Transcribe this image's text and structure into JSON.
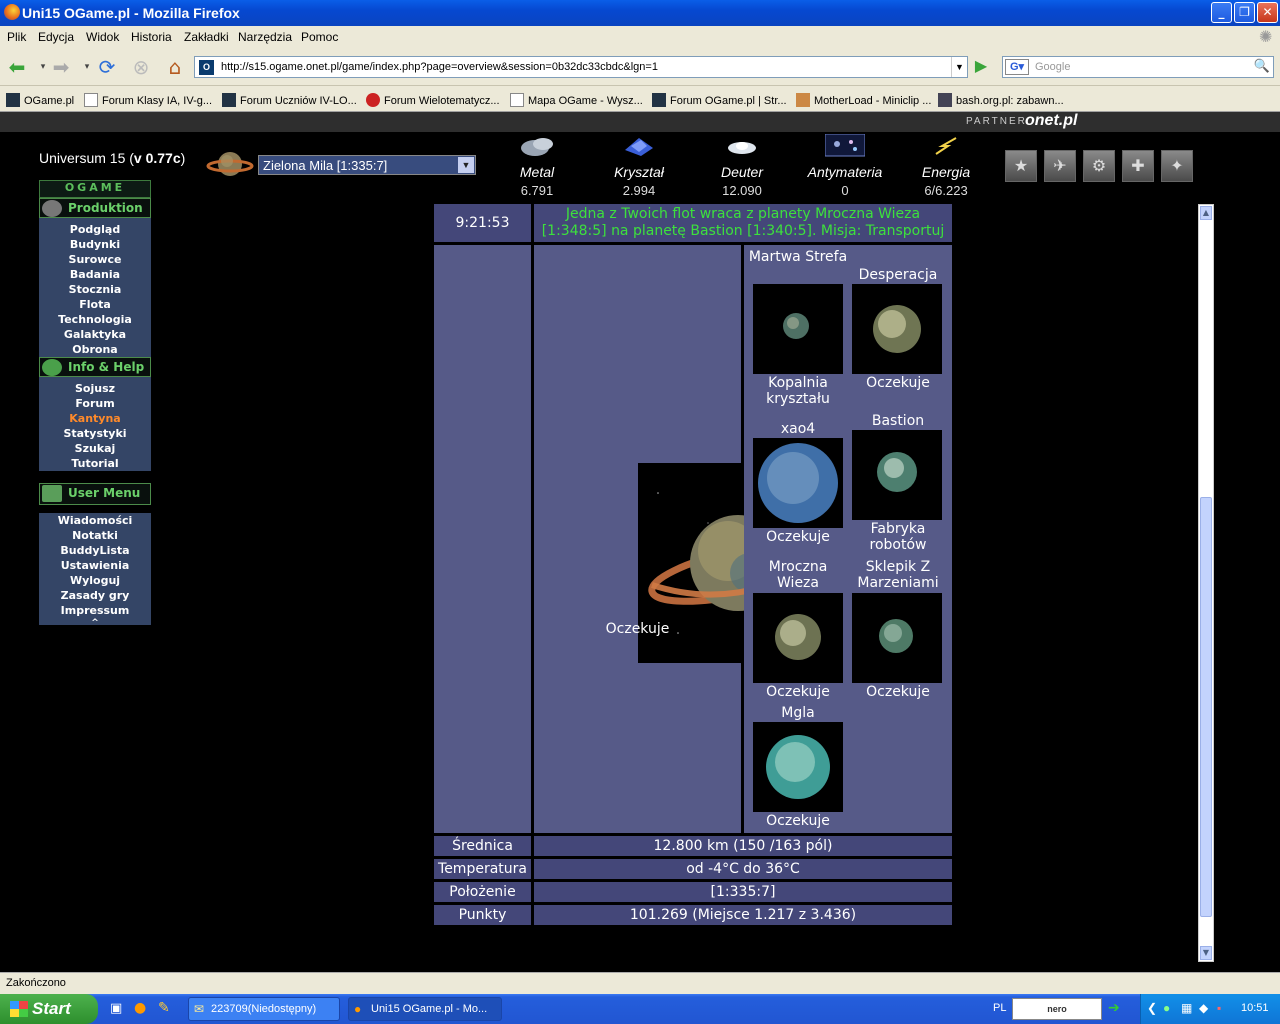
{
  "window": {
    "title": "Uni15 OGame.pl - Mozilla Firefox"
  },
  "menubar": [
    "Plik",
    "Edycja",
    "Widok",
    "Historia",
    "Zakładki",
    "Narzędzia",
    "Pomoc"
  ],
  "url": "http://s15.ogame.onet.pl/game/index.php?page=overview&session=0b32dc33cbdc&lgn=1",
  "search_placeholder": "Google",
  "bookmarks": [
    "OGame.pl",
    "Forum Klasy IA, IV-g...",
    "Forum Uczniów IV-LO...",
    "Forum Wielotematycz...",
    "Mapa OGame - Wysz...",
    "Forum OGame.pl | Str...",
    "MotherLoad - Miniclip ...",
    "bash.org.pl: zabawn..."
  ],
  "partner": {
    "label": "PARTNER",
    "logo": "onet.pl"
  },
  "game": {
    "universe_prefix": "Universum 15 (",
    "universe_version": "v 0.77c",
    "universe_suffix": ")",
    "planet_select": "Zielona Mila [1:335:7]",
    "resources": [
      {
        "name": "Metal",
        "value": "6.791"
      },
      {
        "name": "Kryształ",
        "value": "2.994"
      },
      {
        "name": "Deuter",
        "value": "12.090"
      },
      {
        "name": "Antymateria",
        "value": "0"
      },
      {
        "name": "Energia",
        "value": "6/6.223"
      }
    ]
  },
  "menu": {
    "logo": "OGAME",
    "sections": [
      {
        "title": "Produktion",
        "items": [
          "Podgląd",
          "Budynki",
          "Surowce",
          "Badania",
          "Stocznia",
          "Flota",
          "Technologia",
          "Galaktyka",
          "Obrona"
        ]
      },
      {
        "title": "Info & Help",
        "items": [
          "Sojusz",
          "Forum",
          "Kantyna",
          "Statystyki",
          "Szukaj",
          "Tutorial"
        ]
      },
      {
        "title": "User Menu",
        "items": [
          "Wiadomości",
          "Notatki",
          "BuddyLista",
          "Ustawienia",
          "Wyloguj",
          "Zasady gry",
          "Impressum"
        ]
      }
    ],
    "collapse": "^"
  },
  "overview": {
    "time": "9:21:53",
    "message": "Jedna z Twoich flot wraca z planety Mroczna Wieza [1:348:5] na planetę Bastion [1:340:5]. Misja: Transportuj",
    "main_status": "Oczekuje",
    "planets": [
      {
        "name": "Martwa Strefa",
        "status": "Kopalnia kryształu"
      },
      {
        "name": "Desperacja",
        "status": "Oczekuje"
      },
      {
        "name": "xao4",
        "status": "Oczekuje"
      },
      {
        "name": "Bastion",
        "status": "Fabryka robotów"
      },
      {
        "name": "Mroczna Wieza",
        "status": "Oczekuje"
      },
      {
        "name": "Sklepik Z Marzeniami",
        "status": "Oczekuje"
      },
      {
        "name": "Mgla",
        "status": "Oczekuje"
      }
    ],
    "info": [
      {
        "label": "Średnica",
        "value": "12.800 km (150 /163 pól)"
      },
      {
        "label": "Temperatura",
        "value": "od -4°C do 36°C"
      },
      {
        "label": "Położenie",
        "value": "[1:335:7]"
      },
      {
        "label": "Punkty",
        "value": "101.269 (Miejsce 1.217 z 3.436)"
      }
    ]
  },
  "statusbar": "Zakończono",
  "taskbar": {
    "start": "Start",
    "buttons": [
      "223709(Niedostępny)",
      "Uni15 OGame.pl - Mo..."
    ],
    "lang": "PL",
    "time": "10:51"
  }
}
